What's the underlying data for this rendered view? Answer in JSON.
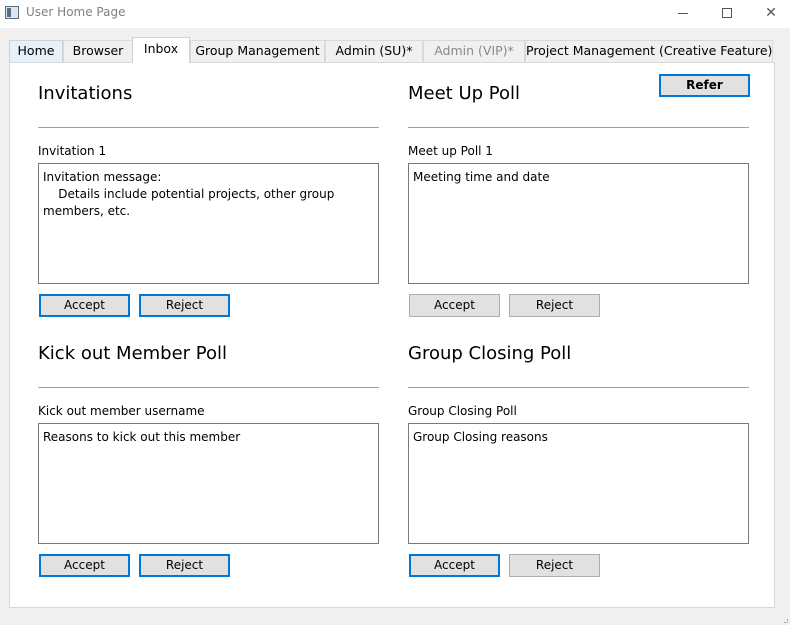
{
  "window": {
    "title": "User Home Page",
    "minimize_icon": "minimize-icon",
    "maximize_icon": "maximize-icon",
    "close_icon": "close-icon",
    "close_glyph": "✕"
  },
  "tabs": [
    {
      "label": "Home",
      "state": "default"
    },
    {
      "label": "Browser",
      "state": "default"
    },
    {
      "label": "Inbox",
      "state": "selected"
    },
    {
      "label": "Group Management",
      "state": "default"
    },
    {
      "label": "Admin (SU)*",
      "state": "default"
    },
    {
      "label": "Admin (VIP)*",
      "state": "disabled"
    },
    {
      "label": "Project Management (Creative Feature)",
      "state": "default"
    }
  ],
  "inbox": {
    "refer_label": "Refer",
    "invitations": {
      "title": "Invitations",
      "item_label": "Invitation 1",
      "message": "Invitation message:\n    Details include potential projects, other group members, etc.",
      "accept_label": "Accept",
      "reject_label": "Reject"
    },
    "meetup_poll": {
      "title": "Meet Up Poll",
      "item_label": "Meet up Poll  1",
      "message": "Meeting time and date",
      "accept_label": "Accept",
      "reject_label": "Reject"
    },
    "kickout_poll": {
      "title": "Kick out Member Poll",
      "item_label": "Kick out member username",
      "message": "Reasons to kick out this member",
      "accept_label": "Accept",
      "reject_label": "Reject"
    },
    "closing_poll": {
      "title": "Group Closing Poll",
      "item_label": "Group Closing Poll",
      "message": "Group Closing reasons",
      "accept_label": "Accept",
      "reject_label": "Reject"
    }
  },
  "colors": {
    "focus_border": "#0078d7",
    "button_face": "#e1e1e1",
    "window_bg": "#f0f0f0",
    "first_tab_bg": "#e5f1fb"
  }
}
